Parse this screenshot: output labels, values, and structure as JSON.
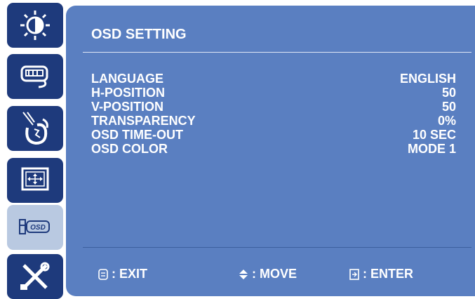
{
  "sidebar": {
    "items": [
      {
        "icon": "brightness-contrast-icon"
      },
      {
        "icon": "signal-source-icon"
      },
      {
        "icon": "audio-icon"
      },
      {
        "icon": "picture-position-icon"
      },
      {
        "icon": "osd-settings-icon",
        "active": true
      },
      {
        "icon": "tools-icon"
      }
    ]
  },
  "panel": {
    "title": "OSD SETTING",
    "rows": [
      {
        "label": "LANGUAGE",
        "value": "ENGLISH"
      },
      {
        "label": "H-POSITION",
        "value": "50"
      },
      {
        "label": "V-POSITION",
        "value": "50"
      },
      {
        "label": "TRANSPARENCY",
        "value": "0%"
      },
      {
        "label": "OSD TIME-OUT",
        "value": "10 SEC"
      },
      {
        "label": "OSD COLOR",
        "value": "MODE 1"
      }
    ]
  },
  "footer": {
    "exit_label": ": EXIT",
    "move_label": ": MOVE",
    "enter_label": ": ENTER"
  },
  "colors": {
    "panel_bg": "#5a7fc1",
    "sidebar_item_bg": "#1e3a7c",
    "sidebar_active_bg": "#b9c9e1"
  }
}
